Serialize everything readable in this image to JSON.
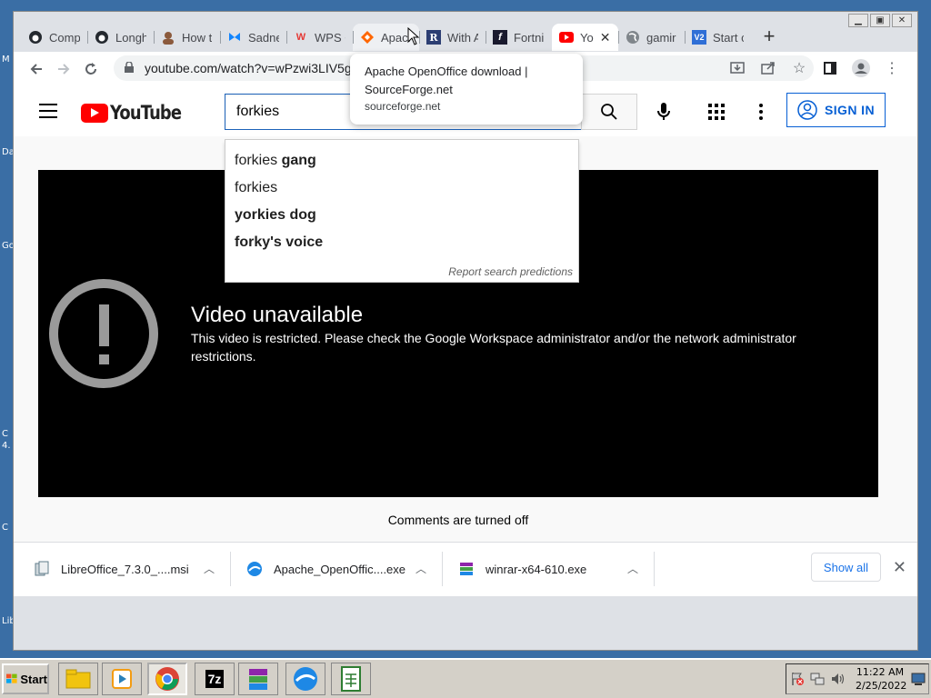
{
  "desktop": {
    "edge_labels": [
      "M",
      "Da",
      "Go",
      "C",
      "4.",
      "C",
      "Lib"
    ]
  },
  "window_controls": [
    "minimize",
    "restore",
    "close"
  ],
  "tabs": [
    {
      "title": "Comp",
      "icon": "github-icon",
      "state": "normal"
    },
    {
      "title": "Longh",
      "icon": "github-icon",
      "state": "normal"
    },
    {
      "title": "How t",
      "icon": "avatar-icon",
      "state": "normal"
    },
    {
      "title": "Sadne",
      "icon": "butterfly-icon",
      "state": "normal"
    },
    {
      "title": "WPS O",
      "icon": "wps-icon",
      "state": "normal"
    },
    {
      "title": "Apach",
      "icon": "sourceforge-icon",
      "state": "hovered"
    },
    {
      "title": "With A",
      "icon": "r-icon",
      "state": "normal"
    },
    {
      "title": "Fortni",
      "icon": "f-icon",
      "state": "normal"
    },
    {
      "title": "Yo",
      "icon": "youtube-icon",
      "state": "active"
    },
    {
      "title": "gamir",
      "icon": "globe-icon",
      "state": "normal"
    },
    {
      "title": "Start c",
      "icon": "v2-icon",
      "state": "normal"
    }
  ],
  "tab_tooltip": {
    "title": "Apache OpenOffice download | SourceForge.net",
    "url": "sourceforge.net"
  },
  "omnibox": {
    "url": "youtube.com/watch?v=wPzwi3LIV5g"
  },
  "youtube": {
    "logo_text": "YouTube",
    "search_value": "forkies",
    "sign_in_label": "SIGN IN",
    "suggestions": [
      {
        "prefix": "forkies",
        "suffix": " gang"
      },
      {
        "prefix": "forkies",
        "suffix": ""
      },
      {
        "prefix": "",
        "suffix": "yorkies dog"
      },
      {
        "prefix": "",
        "suffix": "forky's voice"
      }
    ],
    "report_link": "Report search predictions",
    "error_title": "Video unavailable",
    "error_desc": "This video is restricted. Please check the Google Workspace administrator and/or the network administrator restrictions.",
    "comments": "Comments are turned off"
  },
  "downloads": [
    {
      "name": "LibreOffice_7.3.0_....msi",
      "icon": "msi-icon"
    },
    {
      "name": "Apache_OpenOffic....exe",
      "icon": "openoffice-icon"
    },
    {
      "name": "winrar-x64-610.exe",
      "icon": "winrar-icon"
    }
  ],
  "show_all_label": "Show all",
  "taskbar": {
    "start_label": "Start",
    "quick_launch": [
      "explorer-icon",
      "media-player-icon",
      "chrome-icon",
      "7zip-icon",
      "winrar-icon",
      "openoffice-icon",
      "calc-icon"
    ],
    "seven_zip_label": "7z",
    "clock_time": "11:22 AM",
    "clock_date": "2/25/2022"
  },
  "colors": {
    "youtube_red": "#ff0000",
    "sign_in_blue": "#065fd4",
    "active_tab": "#ffffff",
    "chrome_frame": "#dee1e6"
  }
}
